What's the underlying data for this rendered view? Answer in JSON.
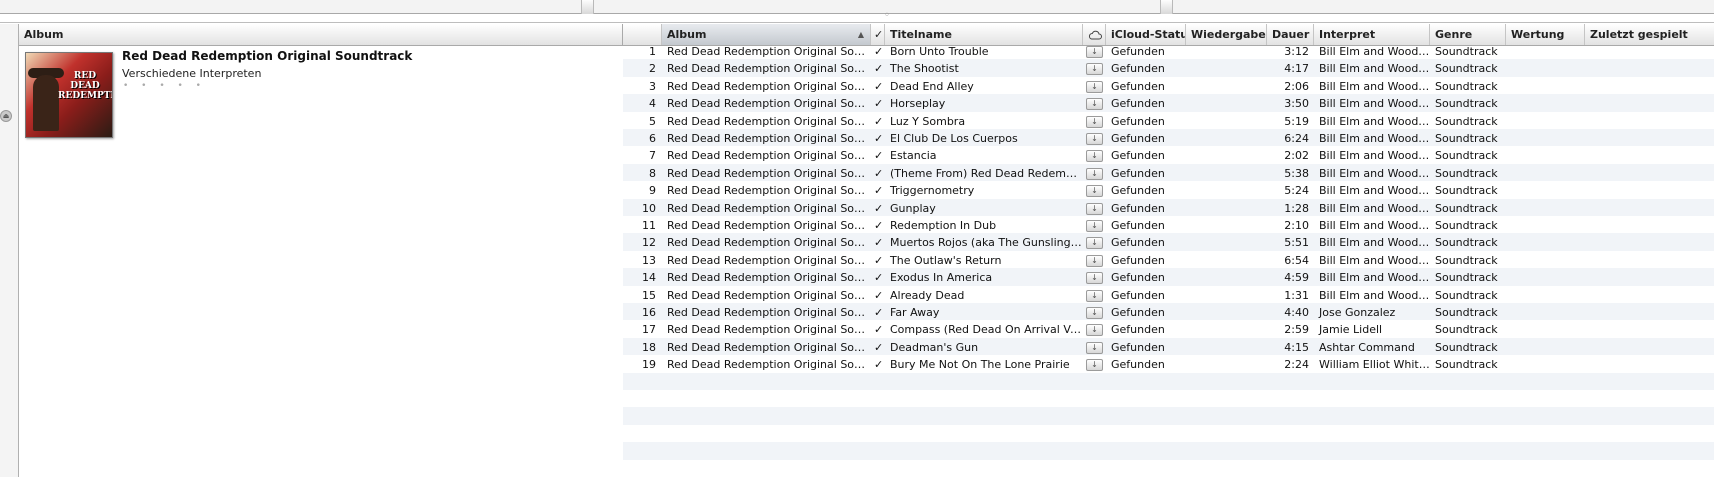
{
  "album_panel": {
    "header": "Album",
    "album_title": "Red Dead Redemption Original Soundtrack",
    "album_artist": "Verschiedene Interpreten",
    "rating_dots": "• • • • •",
    "cover_text": "RED DEAD REDEMPTION"
  },
  "columns": {
    "album": "Album",
    "check": "✓",
    "title": "Titelname",
    "cloud": "cloud-icon",
    "icloud_status": "iCloud-Status",
    "plays": "Wiedergaben",
    "duration": "Dauer",
    "artist": "Interpret",
    "genre": "Genre",
    "rating": "Wertung",
    "last_played": "Zuletzt gespielt"
  },
  "sort_indicator": "▲",
  "tracks": [
    {
      "num": "1",
      "album": "Red Dead Redemption Original Sou...",
      "check": "✓",
      "title": "Born Unto Trouble",
      "status": "Gefunden",
      "duration": "3:12",
      "artist": "Bill Elm and Woody J...",
      "genre": "Soundtrack"
    },
    {
      "num": "2",
      "album": "Red Dead Redemption Original Sou...",
      "check": "✓",
      "title": "The Shootist",
      "status": "Gefunden",
      "duration": "4:17",
      "artist": "Bill Elm and Woody J...",
      "genre": "Soundtrack"
    },
    {
      "num": "3",
      "album": "Red Dead Redemption Original Sou...",
      "check": "✓",
      "title": "Dead End Alley",
      "status": "Gefunden",
      "duration": "2:06",
      "artist": "Bill Elm and Woody J...",
      "genre": "Soundtrack"
    },
    {
      "num": "4",
      "album": "Red Dead Redemption Original Sou...",
      "check": "✓",
      "title": "Horseplay",
      "status": "Gefunden",
      "duration": "3:50",
      "artist": "Bill Elm and Woody J...",
      "genre": "Soundtrack"
    },
    {
      "num": "5",
      "album": "Red Dead Redemption Original Sou...",
      "check": "✓",
      "title": "Luz Y Sombra",
      "status": "Gefunden",
      "duration": "5:19",
      "artist": "Bill Elm and Woody J...",
      "genre": "Soundtrack"
    },
    {
      "num": "6",
      "album": "Red Dead Redemption Original Sou...",
      "check": "✓",
      "title": "El Club De Los Cuerpos",
      "status": "Gefunden",
      "duration": "6:24",
      "artist": "Bill Elm and Woody J...",
      "genre": "Soundtrack"
    },
    {
      "num": "7",
      "album": "Red Dead Redemption Original Sou...",
      "check": "✓",
      "title": "Estancia",
      "status": "Gefunden",
      "duration": "2:02",
      "artist": "Bill Elm and Woody J...",
      "genre": "Soundtrack"
    },
    {
      "num": "8",
      "album": "Red Dead Redemption Original Sou...",
      "check": "✓",
      "title": "(Theme From) Red Dead Redemption",
      "status": "Gefunden",
      "duration": "5:38",
      "artist": "Bill Elm and Woody J...",
      "genre": "Soundtrack"
    },
    {
      "num": "9",
      "album": "Red Dead Redemption Original Sou...",
      "check": "✓",
      "title": "Triggernometry",
      "status": "Gefunden",
      "duration": "5:24",
      "artist": "Bill Elm and Woody J...",
      "genre": "Soundtrack"
    },
    {
      "num": "10",
      "album": "Red Dead Redemption Original Sou...",
      "check": "✓",
      "title": "Gunplay",
      "status": "Gefunden",
      "duration": "1:28",
      "artist": "Bill Elm and Woody J...",
      "genre": "Soundtrack"
    },
    {
      "num": "11",
      "album": "Red Dead Redemption Original Sou...",
      "check": "✓",
      "title": "Redemption In Dub",
      "status": "Gefunden",
      "duration": "2:10",
      "artist": "Bill Elm and Woody J...",
      "genre": "Soundtrack"
    },
    {
      "num": "12",
      "album": "Red Dead Redemption Original Sou...",
      "check": "✓",
      "title": "Muertos Rojos (aka The Gunslinger...",
      "status": "Gefunden",
      "duration": "5:51",
      "artist": "Bill Elm and Woody J...",
      "genre": "Soundtrack"
    },
    {
      "num": "13",
      "album": "Red Dead Redemption Original Sou...",
      "check": "✓",
      "title": "The Outlaw's Return",
      "status": "Gefunden",
      "duration": "6:54",
      "artist": "Bill Elm and Woody J...",
      "genre": "Soundtrack"
    },
    {
      "num": "14",
      "album": "Red Dead Redemption Original Sou...",
      "check": "✓",
      "title": "Exodus In America",
      "status": "Gefunden",
      "duration": "4:59",
      "artist": "Bill Elm and Woody J...",
      "genre": "Soundtrack"
    },
    {
      "num": "15",
      "album": "Red Dead Redemption Original Sou...",
      "check": "✓",
      "title": "Already Dead",
      "status": "Gefunden",
      "duration": "1:31",
      "artist": "Bill Elm and Woody J...",
      "genre": "Soundtrack"
    },
    {
      "num": "16",
      "album": "Red Dead Redemption Original Sou...",
      "check": "✓",
      "title": "Far Away",
      "status": "Gefunden",
      "duration": "4:40",
      "artist": "Jose Gonzalez",
      "genre": "Soundtrack"
    },
    {
      "num": "17",
      "album": "Red Dead Redemption Original Sou...",
      "check": "✓",
      "title": "Compass (Red Dead On Arrival Vers...",
      "status": "Gefunden",
      "duration": "2:59",
      "artist": "Jamie Lidell",
      "genre": "Soundtrack"
    },
    {
      "num": "18",
      "album": "Red Dead Redemption Original Sou...",
      "check": "✓",
      "title": "Deadman's Gun",
      "status": "Gefunden",
      "duration": "4:15",
      "artist": "Ashtar Command",
      "genre": "Soundtrack"
    },
    {
      "num": "19",
      "album": "Red Dead Redemption Original Sou...",
      "check": "✓",
      "title": "Bury Me Not On The Lone Prairie",
      "status": "Gefunden",
      "duration": "2:24",
      "artist": "William Elliot Whitm...",
      "genre": "Soundtrack"
    }
  ],
  "colors": {
    "row_alt": "#f1f4f8",
    "header_bg": "#e2e2e2",
    "sorted_header": "#c4c9cf"
  }
}
